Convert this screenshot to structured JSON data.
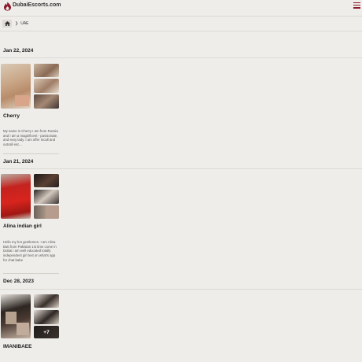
{
  "header": {
    "site_name": "DubaiEscorts.com",
    "logo_icon": "flame-logo-icon",
    "menu_icon": "hamburger-menu-icon",
    "brand_color": "#8b1a2b"
  },
  "breadcrumb": {
    "home_icon": "home-icon",
    "current": "UAE"
  },
  "listings": [
    {
      "date": "Jan 22, 2024",
      "name": "Cherry",
      "description": "My name is Cherry I am from Russia and I am a magnificent - passionate, and sexy lady. I am offer Incall and outcall esc..."
    },
    {
      "date": "Jan 21, 2024",
      "name": "Alina indian girl",
      "description": "Hello my hot gentlemen. I am Alina Butt from Pakistan 1st time come in Dubai i am well educated totally independent girl text on what's app for chat babe"
    },
    {
      "date": "Dec 28, 2023",
      "name": "IMANIBAEE",
      "more_photos": "+7",
      "description": ""
    }
  ]
}
